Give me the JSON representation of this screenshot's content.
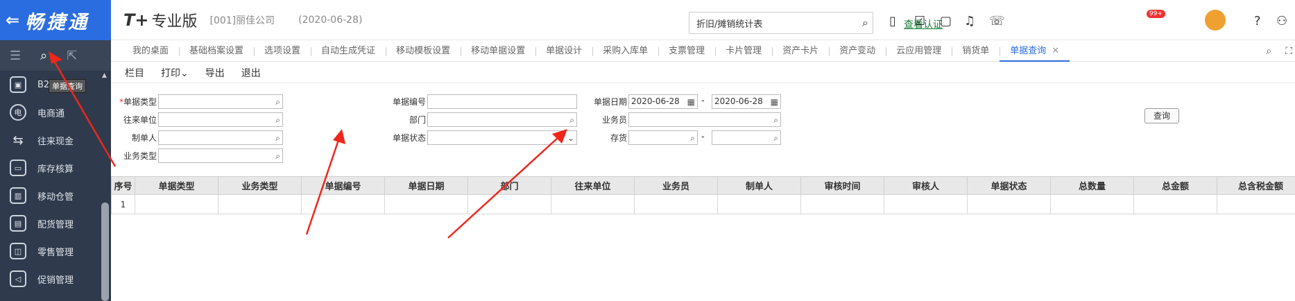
{
  "brand": {
    "back_glyph": "⇐",
    "name": "畅捷通"
  },
  "sidebar": {
    "tooltip": "单据查询",
    "items": [
      {
        "label": "B2",
        "icon": "bag-icon"
      },
      {
        "label": "电商通",
        "icon": "ecommerce-icon"
      },
      {
        "label": "往来现金",
        "icon": "exchange-icon"
      },
      {
        "label": "库存核算",
        "icon": "warehouse-icon"
      },
      {
        "label": "移动仓管",
        "icon": "mobile-warehouse-icon"
      },
      {
        "label": "配货管理",
        "icon": "delivery-icon"
      },
      {
        "label": "零售管理",
        "icon": "retail-icon"
      },
      {
        "label": "促销管理",
        "icon": "promotion-icon"
      }
    ]
  },
  "header": {
    "logo": "T+",
    "edition": "专业版",
    "company": "[001]丽佳公司",
    "date": "(2020-06-28)",
    "search_value": "折旧/摊销统计表",
    "auth_link": "查看认证",
    "badge": "99+"
  },
  "tabs": [
    {
      "label": "我的桌面"
    },
    {
      "label": "基础档案设置"
    },
    {
      "label": "选项设置"
    },
    {
      "label": "自动生成凭证"
    },
    {
      "label": "移动模板设置"
    },
    {
      "label": "移动单据设置"
    },
    {
      "label": "单据设计"
    },
    {
      "label": "采购入库单"
    },
    {
      "label": "支票管理"
    },
    {
      "label": "卡片管理"
    },
    {
      "label": "资产卡片"
    },
    {
      "label": "资产变动"
    },
    {
      "label": "云应用管理"
    },
    {
      "label": "销货单"
    },
    {
      "label": "单据查询",
      "active": true
    }
  ],
  "toolbar": {
    "columns": "栏目",
    "print": "打印",
    "export": "导出",
    "exit": "退出"
  },
  "form": {
    "doc_type": "单据类型",
    "partner": "往来单位",
    "creator": "制单人",
    "biz_type": "业务类型",
    "doc_no": "单据编号",
    "dept": "部门",
    "doc_status": "单据状态",
    "doc_date": "单据日期",
    "date_from": "2020-06-28",
    "date_to": "2020-06-28",
    "salesman": "业务员",
    "inventory": "存货",
    "query": "查询"
  },
  "grid": {
    "columns": [
      "序号",
      "单据类型",
      "业务类型",
      "单据编号",
      "单据日期",
      "部门",
      "往来单位",
      "业务员",
      "制单人",
      "审核时间",
      "审核人",
      "单据状态",
      "总数量",
      "总金额",
      "总含税金额"
    ],
    "rows": [
      [
        "1",
        "",
        "",
        "",
        "",
        "",
        "",
        "",
        "",
        "",
        "",
        "",
        "",
        "",
        ""
      ]
    ]
  }
}
